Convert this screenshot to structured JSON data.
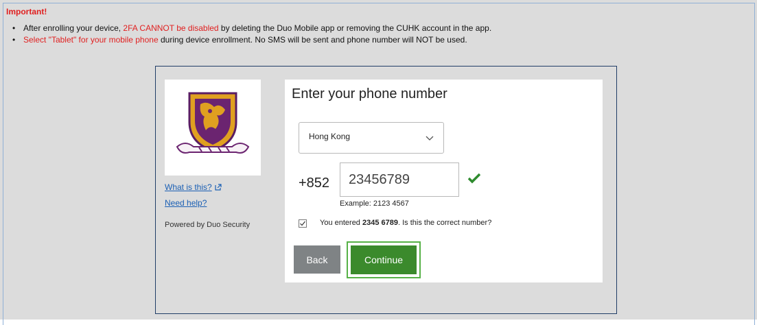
{
  "notice": {
    "heading": "Important!",
    "item1_prefix": "After enrolling your device, ",
    "item1_highlight": "2FA CANNOT be disabled",
    "item1_suffix": " by deleting the Duo Mobile app or removing the CUHK account in the app.",
    "item2_highlight": "Select \"Tablet\" for your mobile phone",
    "item2_suffix": " during device enrollment. No SMS will be sent and phone number will NOT be used."
  },
  "sidebar": {
    "what_is_this": "What is this?",
    "need_help": "Need help?",
    "powered_by": "Powered by Duo Security"
  },
  "enroll": {
    "title": "Enter your phone number",
    "country_selected": "Hong Kong",
    "country_code": "+852",
    "phone_value": "23456789",
    "example": "Example: 2123 4567",
    "confirm_prefix": "You entered ",
    "confirm_number": "2345 6789",
    "confirm_suffix": ". Is this the correct number?",
    "back_label": "Back",
    "continue_label": "Continue"
  },
  "icons": {
    "external_link": "external-link-icon",
    "chevron": "chevron-down-icon",
    "valid": "checkmark-icon",
    "checkbox": "checkbox-checked-icon"
  },
  "colors": {
    "alert_red": "#e02020",
    "link_blue": "#1a5fb4",
    "continue_green": "#3b8a2c",
    "back_gray": "#7f8385",
    "crest_gold": "#e0a020",
    "crest_purple": "#6b2470"
  }
}
